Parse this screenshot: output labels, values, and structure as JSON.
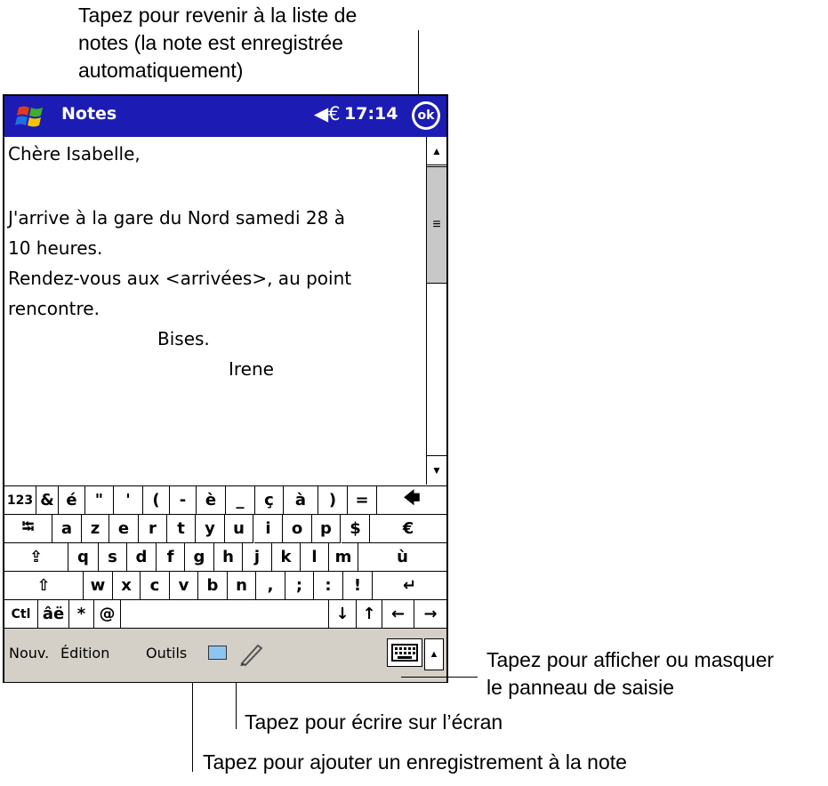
{
  "callouts": {
    "top": "Tapez pour revenir à la liste de\nnotes (la note est enregistrée\nautomatiquement)",
    "right": "Tapez pour afficher ou masquer\nle panneau de saisie",
    "middle": "Tapez pour écrire sur l’écran",
    "bottom": "Tapez pour ajouter un enregistrement à la note"
  },
  "titlebar": {
    "app_name": "Notes",
    "speaker_glyph": "◀€",
    "time": "17:14",
    "ok_label": "ok",
    "color": "#1c1cb4"
  },
  "note": {
    "lines": [
      "Chère Isabelle,",
      "",
      "J'arrive à la gare du Nord samedi 28 à",
      "10 heures.",
      "Rendez-vous aux <arrivées>, au point",
      "rencontre.",
      "Bises.",
      "Irene"
    ]
  },
  "scrollbar": {
    "up": "▲",
    "down": "▼",
    "thumb": "≡"
  },
  "keyboard": {
    "rows": [
      [
        "123",
        "&",
        "é",
        "\"",
        "'",
        "(",
        "-",
        "è",
        "_",
        "ç",
        "à",
        ")",
        "=",
        "🡄"
      ],
      [
        "⭾",
        "a",
        "z",
        "e",
        "r",
        "t",
        "y",
        "u",
        "i",
        "o",
        "p",
        "$",
        "€"
      ],
      [
        "⇪",
        "q",
        "s",
        "d",
        "f",
        "g",
        "h",
        "j",
        "k",
        "l",
        "m",
        "ù"
      ],
      [
        "⇧",
        "w",
        "x",
        "c",
        "v",
        "b",
        "n",
        ",",
        ";",
        ":",
        "!",
        "↵"
      ],
      [
        "Ctl",
        "âë",
        "*",
        "@",
        "",
        "↓",
        "↑",
        "←",
        "→"
      ]
    ]
  },
  "menubar": {
    "items": [
      "Nouv.",
      "Édition",
      "Outils"
    ],
    "recording_icon": "recording-icon",
    "pen_icon": "pen-icon",
    "keyboard_icon": "keyboard-icon",
    "sip_arrow": "▲"
  }
}
